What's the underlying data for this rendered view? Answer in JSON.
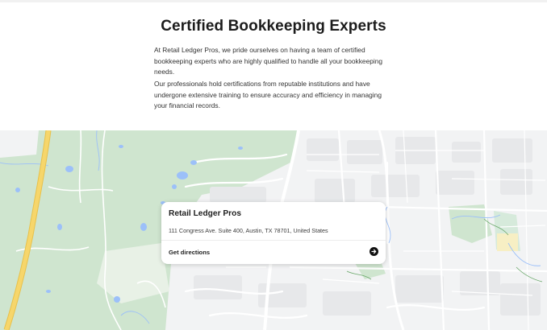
{
  "section": {
    "title": "Certified Bookkeeping Experts",
    "paragraphs": [
      "At Retail Ledger Pros, we pride ourselves on having a team of certified bookkeeping experts who are highly qualified to handle all your bookkeeping needs.",
      "Our professionals hold certifications from reputable institutions and have undergone extensive training to ensure accuracy and efficiency in managing your financial records."
    ]
  },
  "location_card": {
    "business_name": "Retail Ledger Pros",
    "address": "111 Congress Ave. Suite 400, Austin, TX 78701, United States",
    "directions_label": "Get directions",
    "directions_icon": "arrow-right-circle-icon"
  },
  "colors": {
    "park_green": "#cfe5cf",
    "highway_yellow": "#f6d66b",
    "water_blue": "#9cc0f9",
    "road_white": "#ffffff",
    "map_background": "#f2f3f4"
  }
}
